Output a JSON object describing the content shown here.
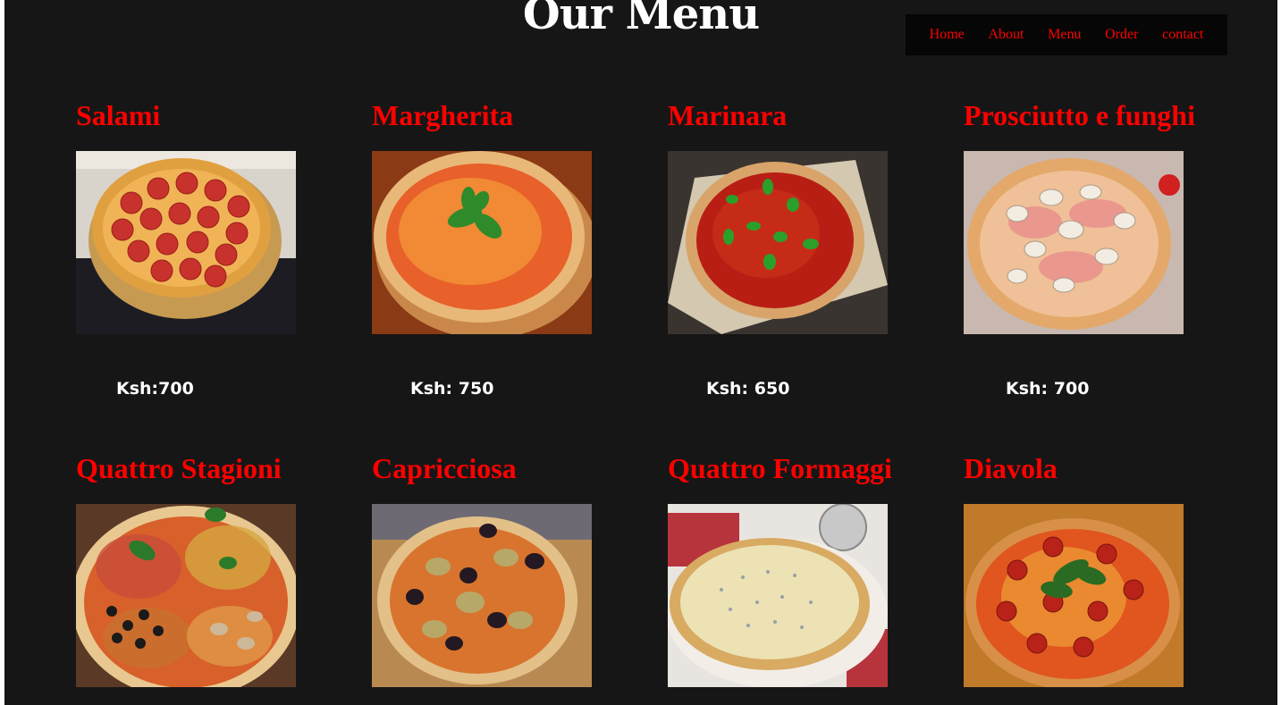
{
  "page_title": "Our Menu",
  "nav": {
    "items": [
      {
        "label": "Home"
      },
      {
        "label": "About"
      },
      {
        "label": "Menu"
      },
      {
        "label": "Order"
      },
      {
        "label": "contact"
      }
    ]
  },
  "colors": {
    "background": "#161616",
    "accent": "#ff0000",
    "nav_background": "#060606",
    "text": "#ffffff"
  },
  "menu": {
    "items": [
      {
        "name": "Salami",
        "price": "Ksh:700",
        "image_icon": "salami-pizza-image"
      },
      {
        "name": "Margherita",
        "price": "Ksh: 750",
        "image_icon": "margherita-pizza-image"
      },
      {
        "name": "Marinara",
        "price": "Ksh: 650",
        "image_icon": "marinara-pizza-image"
      },
      {
        "name": "Prosciutto e funghi",
        "price": "Ksh: 700",
        "image_icon": "prosciutto-funghi-pizza-image"
      },
      {
        "name": "Quattro Stagioni",
        "image_icon": "quattro-stagioni-pizza-image"
      },
      {
        "name": "Capricciosa",
        "image_icon": "capricciosa-pizza-image"
      },
      {
        "name": "Quattro Formaggi",
        "image_icon": "quattro-formaggi-pizza-image"
      },
      {
        "name": "Diavola",
        "image_icon": "diavola-pizza-image"
      }
    ]
  }
}
